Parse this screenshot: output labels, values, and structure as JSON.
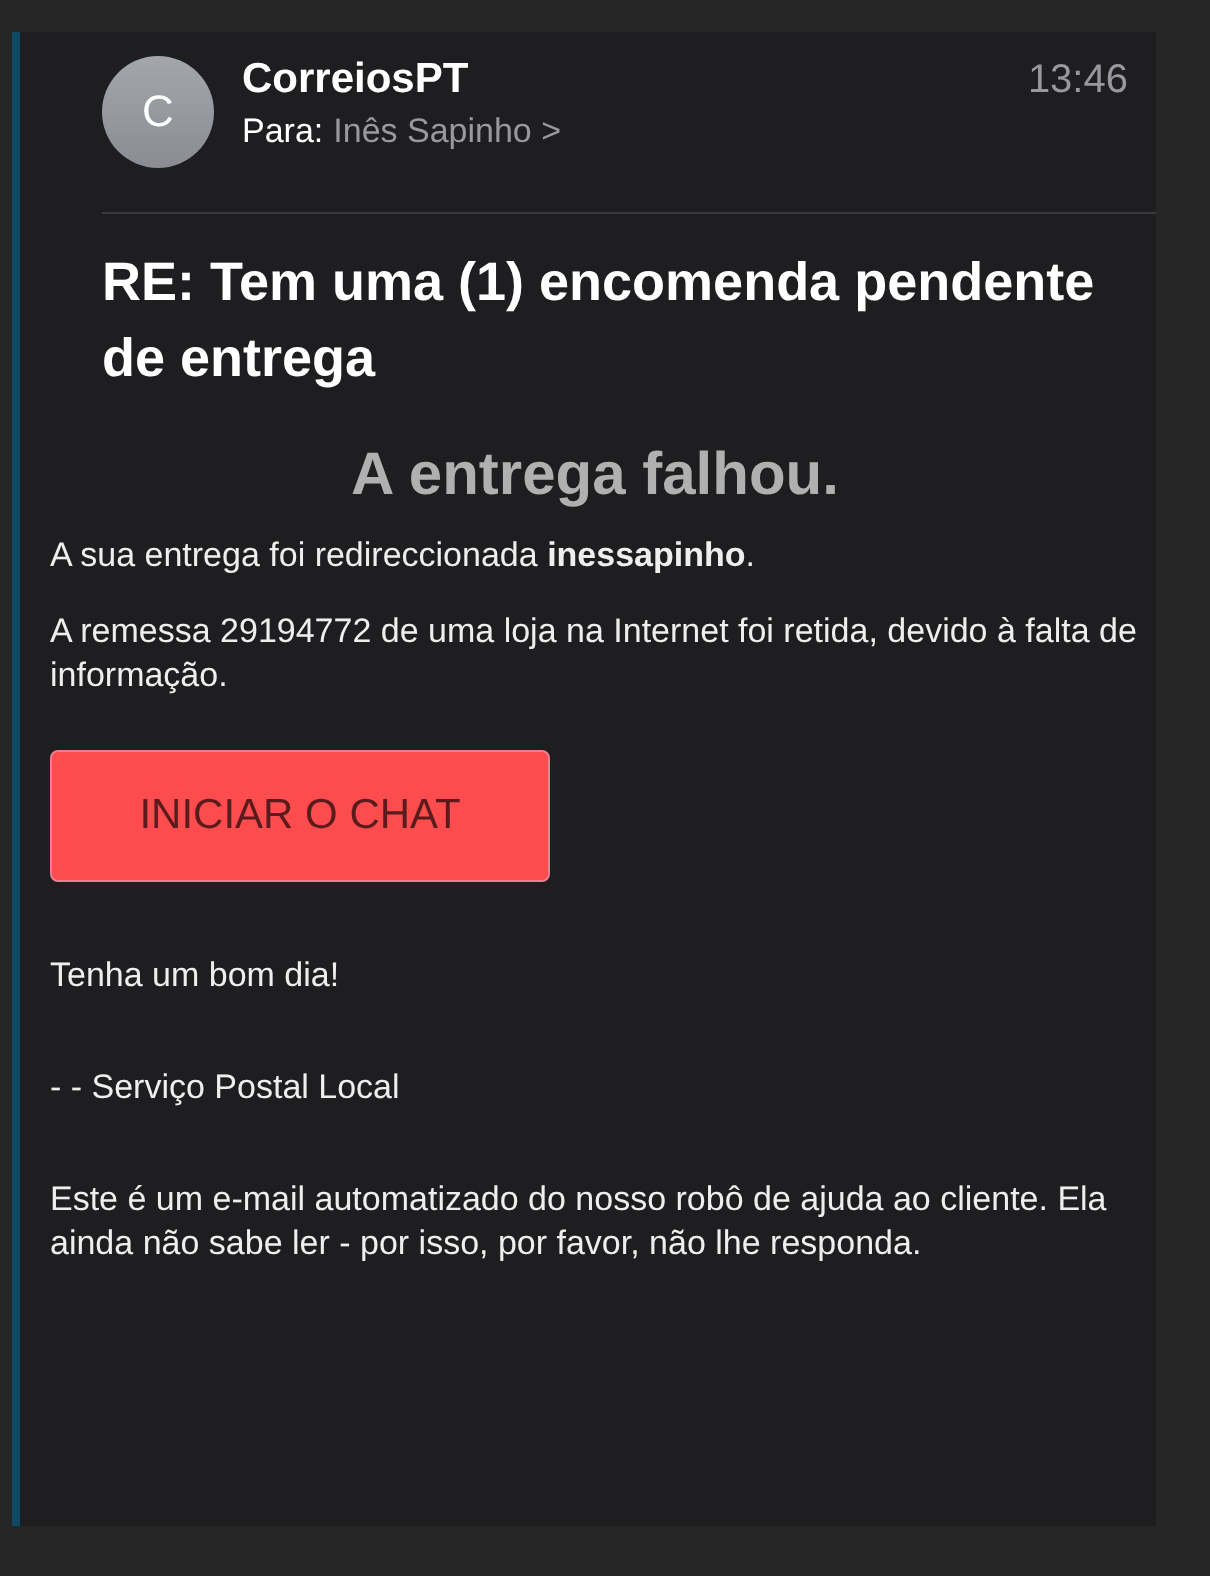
{
  "header": {
    "avatar_letter": "C",
    "sender": "CorreiosPT",
    "to_label": "Para:",
    "recipient": "Inês Sapinho",
    "chevron": ">",
    "time": "13:46"
  },
  "subject": "RE: Tem uma (1) encomenda pendente de entrega",
  "body": {
    "heading": "A entrega falhou.",
    "paragraphs_before": [
      "A sua entrega foi redireccionada **inessapinho**.",
      "A remessa 29194772 de uma loja na Internet foi retida, devido à falta de informação."
    ],
    "button": "INICIAR O CHAT",
    "paragraphs_after": [
      "Tenha um bom dia!",
      "-  - Serviço Postal Local",
      "Este é um e-mail automatizado do nosso robô de ajuda ao cliente. Ela ainda não sabe ler - por isso, por favor, não lhe responda."
    ]
  }
}
